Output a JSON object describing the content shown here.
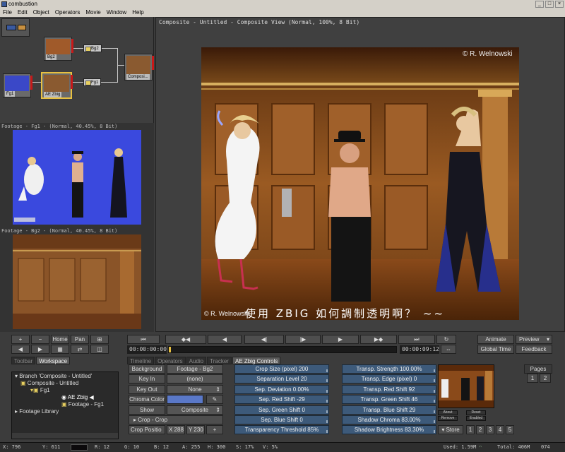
{
  "app": {
    "title": "combustion"
  },
  "menu": [
    "File",
    "Edit",
    "Object",
    "Operators",
    "Movie",
    "Window",
    "Help"
  ],
  "nodes": {
    "footage1": "Fg1",
    "footage2": "Bg2",
    "bg2_op": "Bg2",
    "ae_op": "AE Zbig",
    "fg1_op": "Fg1",
    "composite": "Composi..."
  },
  "footage_views": {
    "fg1_title": "Footage - Fg1 - (Normal, 40.45%, 8 Bit)",
    "bg2_title": "Footage - Bg2 - (Normal, 40.45%, 8 Bit)"
  },
  "viewer": {
    "title": "Composite - Untitled - Composite View (Normal, 100%, 8 Bit)",
    "copyright_top": "© R. Welnowski",
    "copyright_bottom": "© R. Welnowski",
    "caption": "使用 ZBIG 如何調制透明啊？ ~~"
  },
  "transport": {
    "home": "Home",
    "pan": "Pan",
    "timecode_start": "00:00:00:00",
    "timecode_end": "00:00:09:12",
    "animate": "Animate",
    "preview": "Preview",
    "global_time": "Global Time",
    "feedback": "Feedback"
  },
  "tabs": [
    "Toolbar",
    "Workspace",
    "Timeline",
    "Operators",
    "Audio",
    "Tracker",
    "AE Zbig Controls"
  ],
  "tree": [
    "Branch 'Composite - Untitled'",
    "Composite - Untitled",
    "Fg1",
    "AE Zbig",
    "Footage - Fg1",
    "Footage Library"
  ],
  "props": {
    "background_label": "Background",
    "background_value": "Footage - Bg2",
    "keyin_label": "Key In",
    "keyin_value": "(none)",
    "keyout_label": "Key Out",
    "keyout_value": "None",
    "chroma_label": "Chroma Color",
    "chroma_color": "#5a78c8",
    "show_label": "Show",
    "show_value": "Composite",
    "crop_label": "Crop - Crop",
    "cropos_label": "Crop Positio",
    "crop_x": "X 288",
    "crop_y": "Y 230"
  },
  "sliders_left": [
    "Crop Size (pixel) 200",
    "Separation Level 20",
    "Sep. Deviation 0.00%",
    "Sep. Red Shift -29",
    "Sep. Green Shift 0",
    "Sep. Blue Shift 0",
    "Transparency Threshold 85%"
  ],
  "sliders_right": [
    "Transp. Strength 100.00%",
    "Transp. Edge (pixel) 0",
    "Transp. Red Shift 92",
    "Transp. Green Shift 46",
    "Transp. Blue Shift 29",
    "Shadow Chroma 83.00%",
    "Shadow Brightness 83.30%"
  ],
  "plugin_buttons": {
    "about": "About",
    "reset": "Reset",
    "remove": "Remove",
    "enabled": "Enabled"
  },
  "pages": {
    "label": "Pages",
    "items": [
      "1",
      "2"
    ]
  },
  "store": {
    "label": "Store",
    "items": [
      "1",
      "2",
      "3",
      "4",
      "5"
    ]
  },
  "status": {
    "x": "X:   796",
    "y": "Y:  611",
    "r": "R: 12",
    "g": "G: 10",
    "b": "B: 12",
    "a": "A: 255",
    "h": "H: 300",
    "s": "S: 17%",
    "v": "V: 5%",
    "used": "Used: 1.59M",
    "total": "Total: 406M",
    "num": "074"
  }
}
